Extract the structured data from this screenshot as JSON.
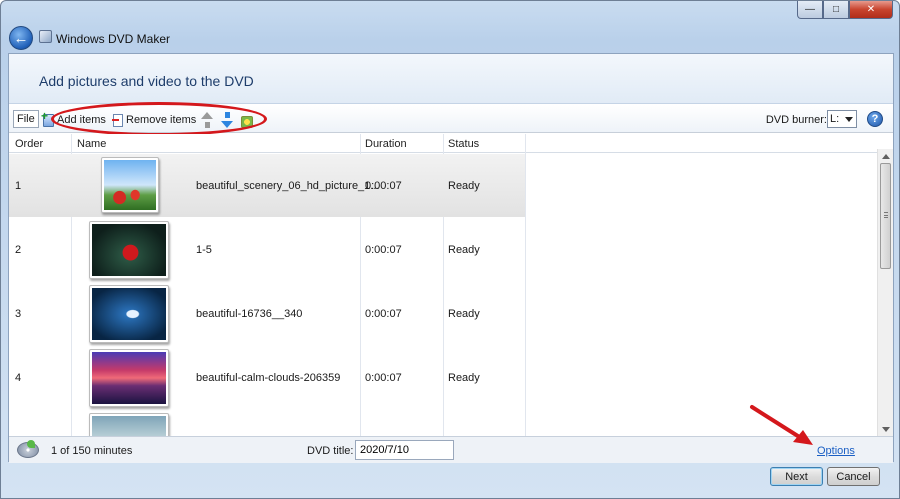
{
  "window": {
    "title": "Windows DVD Maker"
  },
  "page": {
    "heading": "Add pictures and video to the DVD"
  },
  "toolbar": {
    "file_label": "File",
    "add_items_label": "Add items",
    "remove_items_label": "Remove items",
    "burner_label": "DVD burner:",
    "burner_value": "L:"
  },
  "list": {
    "columns": [
      "Order",
      "Name",
      "Duration",
      "Status"
    ],
    "rows": [
      {
        "order": "1",
        "name": "beautiful_scenery_06_hd_picture_1...",
        "duration": "0:00:07",
        "status": "Ready",
        "thumb": "red flowers under blue sky"
      },
      {
        "order": "2",
        "name": "1-5",
        "duration": "0:00:07",
        "status": "Ready",
        "thumb": "red flower on dark green"
      },
      {
        "order": "3",
        "name": "beautiful-16736__340",
        "duration": "0:00:07",
        "status": "Ready",
        "thumb": "swan on blue water"
      },
      {
        "order": "4",
        "name": "beautiful-calm-clouds-206359",
        "duration": "0:00:07",
        "status": "Ready",
        "thumb": "pink sunset over lake"
      },
      {
        "order": "",
        "name": "",
        "duration": "",
        "status": "",
        "thumb": "lake landscape"
      }
    ]
  },
  "status": {
    "minutes": "1 of 150 minutes",
    "dvd_title_label": "DVD title:",
    "dvd_title_value": "2020/7/10",
    "options_label": "Options"
  },
  "buttons": {
    "next": "Next",
    "cancel": "Cancel"
  },
  "colors": {
    "annotation_red": "#d4181c",
    "link_blue": "#1a5fc4"
  }
}
